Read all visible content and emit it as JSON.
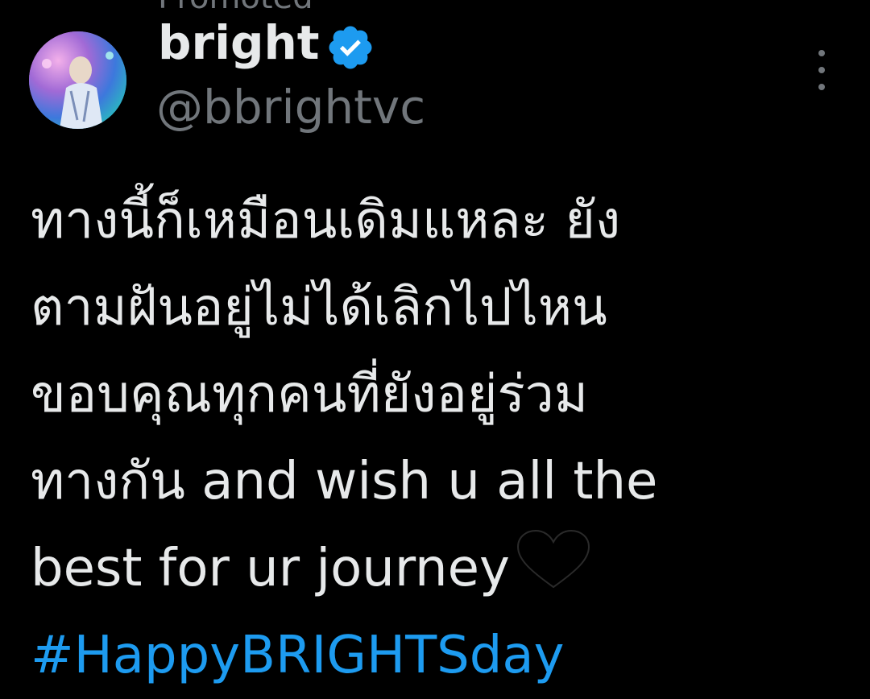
{
  "header": {
    "top_fragment": "Promoted",
    "display_name": "bright",
    "handle": "@bbrightvc",
    "verified_icon": "verified-badge-icon",
    "more_icon": "more-options-icon"
  },
  "tweet": {
    "lines": [
      "ทางนี้ก็เหมือนเดิมแหละ ยัง",
      "ตามฝันอยู่ไม่ได้เลิกไปไหน",
      "ขอบคุณทุกคนที่ยังอยู่ร่วม",
      "ทางกัน and wish u all the",
      "best for ur journey"
    ],
    "emoji": "black-heart-icon",
    "hashtag": "#HappyBRIGHTSday"
  },
  "colors": {
    "background": "#000000",
    "text": "#e7e9ea",
    "secondary": "#71767b",
    "accent": "#1d9bf0"
  }
}
